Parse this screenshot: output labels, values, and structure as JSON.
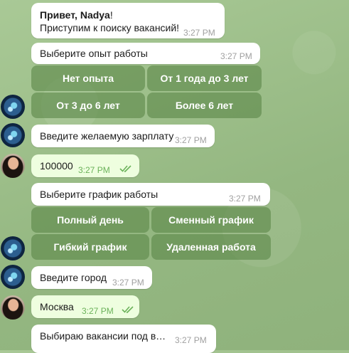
{
  "messages": {
    "greeting": {
      "line1_bold": "Привет, Nadya",
      "line1_tail": "!",
      "line2": "Приступим к поиску вакансий!",
      "time": "3:27 PM"
    },
    "experience_prompt": {
      "text": "Выберите опыт работы",
      "time": "3:27 PM"
    },
    "salary_prompt": {
      "text": "Введите желаемую зарплату",
      "time": "3:27 PM"
    },
    "salary_reply": {
      "text": "100000",
      "time": "3:27 PM"
    },
    "schedule_prompt": {
      "text": "Выберите график работы",
      "time": "3:27 PM"
    },
    "city_prompt": {
      "text": "Введите город",
      "time": "3:27 PM"
    },
    "city_reply": {
      "text": "Москва",
      "time": "3:27 PM"
    },
    "vacancies": {
      "text": "Выбираю вакансии под вас...",
      "time": "3:27 PM"
    }
  },
  "experience_buttons": [
    "Нет опыта",
    "От 1 года до 3 лет",
    "От 3 до 6 лет",
    "Более 6 лет"
  ],
  "schedule_buttons": [
    "Полный день",
    "Сменный график",
    "Гибкий график",
    "Удаленная работа"
  ],
  "colors": {
    "background": "#9cbc8a",
    "incoming_bubble": "#ffffff",
    "outgoing_bubble": "#eefedf",
    "button": "#5c8748",
    "read_check": "#6bb25a"
  },
  "icons": {
    "bot_avatar": "bot-avatar",
    "user_avatar": "user-avatar",
    "read_receipt": "double-check-icon"
  }
}
